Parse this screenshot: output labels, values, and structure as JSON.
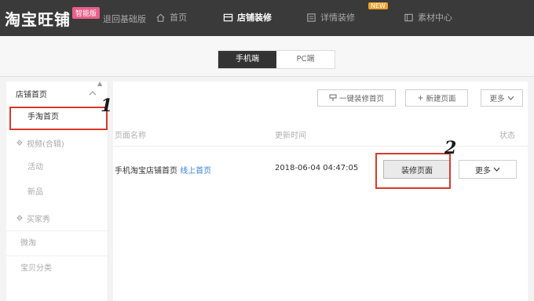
{
  "topbar": {
    "logo": "淘宝旺铺",
    "edition_badge": "智能版",
    "back_link": "退回基础版",
    "nav": [
      {
        "label": "首页",
        "icon": "home-icon"
      },
      {
        "label": "店铺装修",
        "icon": "shop-icon",
        "active": true
      },
      {
        "label": "详情装修",
        "icon": "detail-page-icon"
      },
      {
        "label": "素材中心",
        "icon": "folder-icon"
      }
    ],
    "new_badge": "NEW"
  },
  "device_switch": {
    "options": [
      "手机端",
      "PC端"
    ],
    "selected": "手机端"
  },
  "sidebar": {
    "header": "店铺首页",
    "items": [
      {
        "label": "手淘首页",
        "active": true
      },
      {
        "label": "视频(合辑)",
        "icon": "video-icon",
        "group": true
      },
      {
        "label": "活动"
      },
      {
        "label": "新品"
      },
      {
        "label": "买家秀",
        "icon": "buyer-show-icon",
        "group": true
      },
      {
        "label": "微淘"
      },
      {
        "label": "宝贝分类"
      }
    ]
  },
  "toolbar": {
    "one_click": "一键装修首页",
    "new_page": "新建页面",
    "more": "更多"
  },
  "table": {
    "headers": {
      "name": "页面名称",
      "time": "更新时间",
      "status": "状态"
    },
    "rows": [
      {
        "name": "手机淘宝店铺首页",
        "tag": "线上首页",
        "time": "2018-06-04 04:47:05",
        "action": "装修页面",
        "more": "更多"
      }
    ]
  },
  "annotations": {
    "step1": "1",
    "step2": "2",
    "color": "#d63b2a"
  }
}
